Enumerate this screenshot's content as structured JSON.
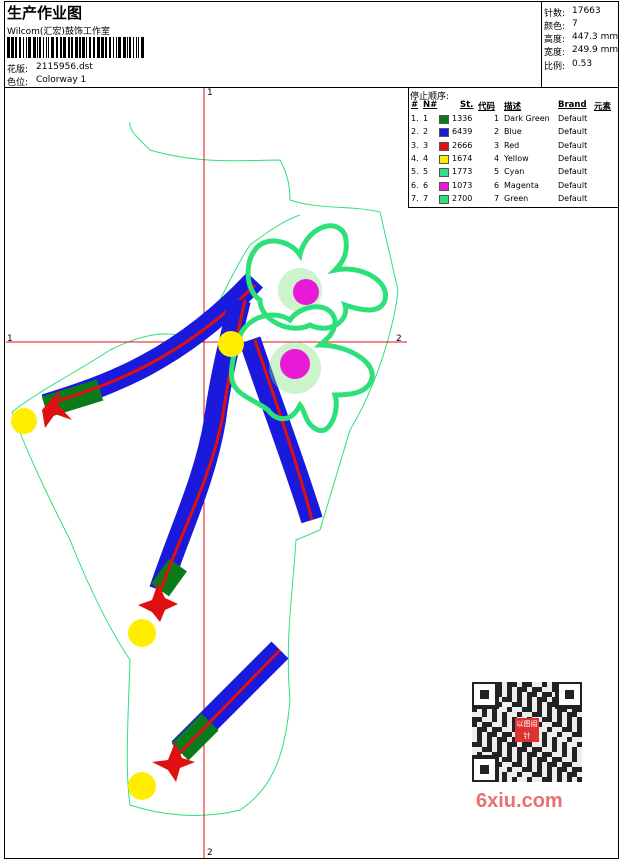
{
  "header": {
    "title": "生产作业图",
    "company": "Wilcom(汇宏)鼓饰工作室",
    "design_label": "花版:",
    "design_value": "2115956.dst",
    "colorway_label": "色位:",
    "colorway_value": "Colorway 1"
  },
  "stats": {
    "stitches_label": "针数:",
    "stitches_value": "17663",
    "colors_label": "颜色:",
    "colors_value": "7",
    "height_label": "高度:",
    "height_value": "447.3 mm",
    "width_label": "宽度:",
    "width_value": "249.9 mm",
    "scale_label": "比例:",
    "scale_value": "0.53"
  },
  "stop_sequence": {
    "title": "停止顺序:",
    "headers": [
      "#",
      "N#",
      "St.",
      "代码",
      "描述",
      "Brand",
      "元素"
    ],
    "rows": [
      {
        "no": "1.",
        "n": "1",
        "st": "1336",
        "code": "1",
        "desc": "Dark Green",
        "brand": "Default",
        "color": "#0a7a1a"
      },
      {
        "no": "2.",
        "n": "2",
        "st": "6439",
        "code": "2",
        "desc": "Blue",
        "brand": "Default",
        "color": "#1a1adc"
      },
      {
        "no": "3.",
        "n": "3",
        "st": "2666",
        "code": "3",
        "desc": "Red",
        "brand": "Default",
        "color": "#e01010"
      },
      {
        "no": "4.",
        "n": "4",
        "st": "1674",
        "code": "4",
        "desc": "Yellow",
        "brand": "Default",
        "color": "#ffee00"
      },
      {
        "no": "5.",
        "n": "5",
        "st": "1773",
        "code": "5",
        "desc": "Cyan",
        "brand": "Default",
        "color": "#2ee08a"
      },
      {
        "no": "6.",
        "n": "6",
        "st": "1073",
        "code": "6",
        "desc": "Magenta",
        "brand": "Default",
        "color": "#e81ad8"
      },
      {
        "no": "7.",
        "n": "7",
        "st": "2700",
        "code": "7",
        "desc": "Green",
        "brand": "Default",
        "color": "#2ee07a"
      }
    ]
  },
  "crosshair": {
    "top": "1",
    "bottom": "2",
    "left": "1",
    "right": "2"
  },
  "watermark": {
    "site": "6xiu.com",
    "seal": "以图阅针"
  },
  "colors": {
    "blue": "#1a1adc",
    "red": "#e01010",
    "green": "#0a7a1a",
    "outline": "#2ee07a",
    "yellow": "#ffee00",
    "magenta": "#e81ad8",
    "crosshair": "#e01010"
  }
}
